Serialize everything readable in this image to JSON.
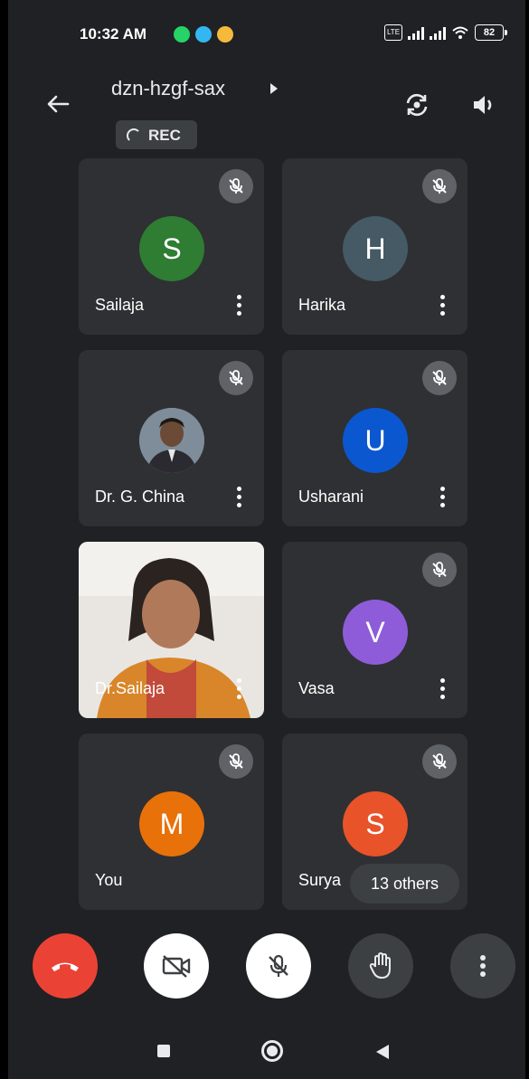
{
  "status_bar": {
    "time": "10:32 AM",
    "battery": "82",
    "notification_icons": [
      "whatsapp-icon",
      "messages-icon",
      "mail-icon"
    ],
    "notification_colors": [
      "#25d366",
      "#34b7f1",
      "#f6b93b"
    ]
  },
  "header": {
    "meeting_code": "dzn-hzgf-sax",
    "rec_label": "REC"
  },
  "participants": [
    {
      "name": "Sailaja",
      "initial": "S",
      "color": "#2e7d32",
      "muted": true,
      "kind": "initial"
    },
    {
      "name": "Harika",
      "initial": "H",
      "color": "#455a64",
      "muted": true,
      "kind": "initial"
    },
    {
      "name": "Dr. G. China",
      "initial": "",
      "color": "#6b7a88",
      "muted": true,
      "kind": "photo"
    },
    {
      "name": "Usharani",
      "initial": "U",
      "color": "#0b57d0",
      "muted": true,
      "kind": "initial"
    },
    {
      "name": "Dr.Sailaja",
      "initial": "",
      "color": "",
      "muted": false,
      "kind": "video"
    },
    {
      "name": "Vasa",
      "initial": "V",
      "color": "#8e5cd9",
      "muted": true,
      "kind": "initial"
    },
    {
      "name": "You",
      "initial": "M",
      "color": "#e8710a",
      "muted": true,
      "kind": "initial"
    },
    {
      "name": "Surya",
      "initial": "S",
      "color": "#e8532a",
      "muted": true,
      "kind": "initial"
    }
  ],
  "others_label": "13 others",
  "controls": {
    "end_call_color": "#ea4335"
  }
}
